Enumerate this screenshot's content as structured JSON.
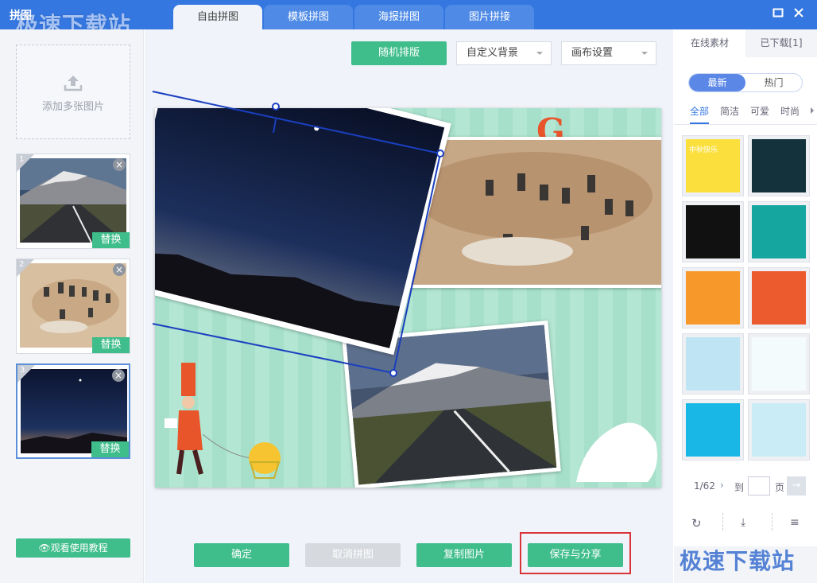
{
  "window": {
    "title": "拼图",
    "watermark": "极速下载站",
    "tabs": [
      "自由拼图",
      "模板拼图",
      "海报拼图",
      "图片拼接"
    ],
    "active_tab": 0,
    "maximize_icon": "maximize-icon",
    "close_icon": "close-icon"
  },
  "left": {
    "add_label": "添加多张图片",
    "thumbnails": [
      {
        "num": "1",
        "replace": "替换",
        "content": "road-mountain"
      },
      {
        "num": "2",
        "replace": "替换",
        "content": "animals-running"
      },
      {
        "num": "3",
        "replace": "替换",
        "content": "night-sky"
      }
    ],
    "tutorial_label": "观看使用教程"
  },
  "toolbar": {
    "random_layout": "随机排版",
    "custom_background": "自定义背景",
    "canvas_settings": "画布设置"
  },
  "canvas": {
    "decor_text": "G light",
    "accent_colors": {
      "bg": "#a8e2cd",
      "selection": "#1a3fbf",
      "orange": "#e8552a"
    }
  },
  "bottom": {
    "confirm": "确定",
    "cancel": "取消拼图",
    "copy": "复制图片",
    "save_share": "保存与分享"
  },
  "right": {
    "tabs": [
      "在线素材",
      "已下载[1]"
    ],
    "active_tab": 0,
    "segments": [
      "最新",
      "热门"
    ],
    "active_segment": 0,
    "categories": [
      "全部",
      "简洁",
      "可爱",
      "时尚"
    ],
    "active_category": 0,
    "templates": [
      {
        "bg": "#fadf3d",
        "text": "中秋快乐"
      },
      {
        "bg": "#14323c",
        "text": ""
      },
      {
        "bg": "#111111",
        "text": ""
      },
      {
        "bg": "#16a6a0",
        "text": ""
      },
      {
        "bg": "#f7992a",
        "text": ""
      },
      {
        "bg": "#ec5b2d",
        "text": ""
      },
      {
        "bg": "#bfe4f3",
        "text": ""
      },
      {
        "bg": "#f4fbfd",
        "text": ""
      },
      {
        "bg": "#19b7e6",
        "text": ""
      },
      {
        "bg": "#c9ecf7",
        "text": ""
      }
    ],
    "pager": {
      "current": "1/62",
      "goto": "到",
      "page": "页",
      "input": ""
    },
    "footer_icons": [
      "refresh-icon",
      "download-icon",
      "layers-icon"
    ]
  }
}
